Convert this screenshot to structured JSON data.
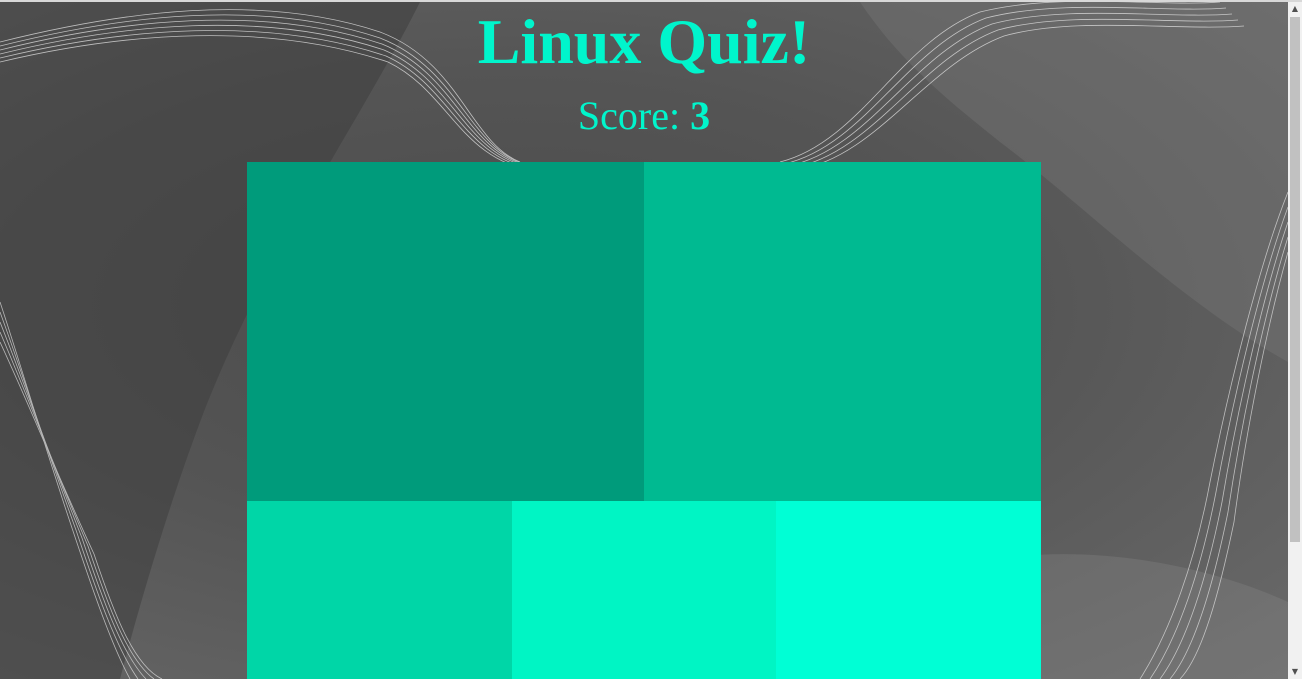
{
  "app": {
    "title": "Linux Quiz!",
    "score_label": "Score:",
    "score_value": "3"
  },
  "colors": {
    "accent_text": "#00f5cc",
    "tile_1": "#009b7b",
    "tile_2": "#00ba91",
    "tile_3": "#00d6a7",
    "tile_4": "#00f5c4",
    "tile_5": "#00ffd5"
  },
  "tiles": [
    {
      "id": "tile-1",
      "color_key": "tile_1"
    },
    {
      "id": "tile-2",
      "color_key": "tile_2"
    },
    {
      "id": "tile-3",
      "color_key": "tile_3"
    },
    {
      "id": "tile-4",
      "color_key": "tile_4"
    },
    {
      "id": "tile-5",
      "color_key": "tile_5"
    }
  ],
  "scrollbar": {
    "up_icon": "triangle-up-icon",
    "down_icon": "triangle-down-icon"
  }
}
